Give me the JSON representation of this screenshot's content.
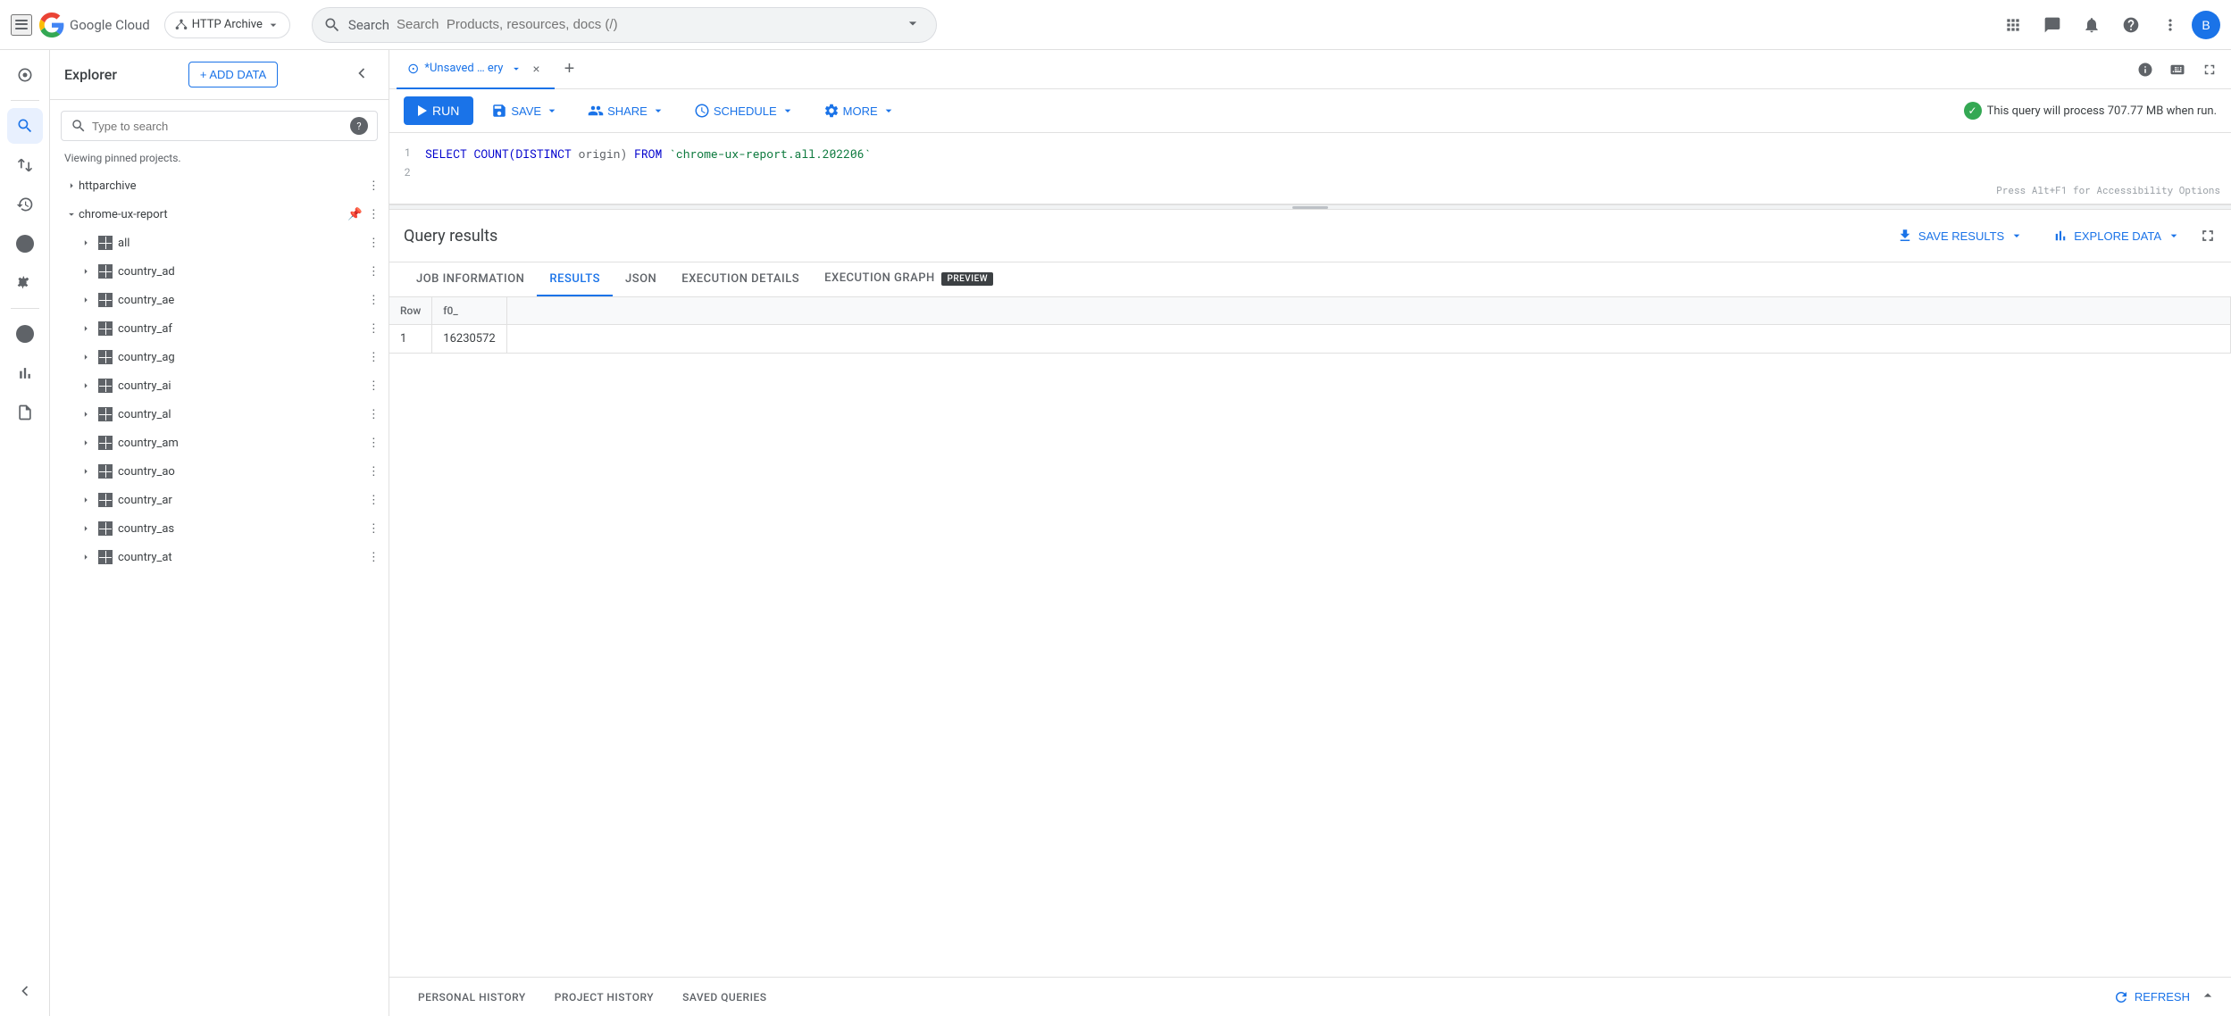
{
  "app": {
    "title": "Google Cloud"
  },
  "topnav": {
    "project_name": "HTTP Archive",
    "search_placeholder": "Search  Products, resources, docs (/)"
  },
  "explorer": {
    "title": "Explorer",
    "add_data_label": "+ ADD DATA",
    "search_placeholder": "Type to search",
    "viewing_text": "Viewing pinned projects.",
    "items": [
      {
        "id": "httparchive",
        "label": "httparchive",
        "level": 0,
        "type": "project",
        "expanded": false,
        "pinned": false
      },
      {
        "id": "chrome-ux-report",
        "label": "chrome-ux-report",
        "level": 0,
        "type": "project",
        "expanded": true,
        "pinned": true
      },
      {
        "id": "all",
        "label": "all",
        "level": 1,
        "type": "dataset",
        "expanded": false
      },
      {
        "id": "country_ad",
        "label": "country_ad",
        "level": 1,
        "type": "dataset",
        "expanded": false
      },
      {
        "id": "country_ae",
        "label": "country_ae",
        "level": 1,
        "type": "dataset",
        "expanded": false
      },
      {
        "id": "country_af",
        "label": "country_af",
        "level": 1,
        "type": "dataset",
        "expanded": false
      },
      {
        "id": "country_ag",
        "label": "country_ag",
        "level": 1,
        "type": "dataset",
        "expanded": false
      },
      {
        "id": "country_ai",
        "label": "country_ai",
        "level": 1,
        "type": "dataset",
        "expanded": false
      },
      {
        "id": "country_al",
        "label": "country_al",
        "level": 1,
        "type": "dataset",
        "expanded": false
      },
      {
        "id": "country_am",
        "label": "country_am",
        "level": 1,
        "type": "dataset",
        "expanded": false
      },
      {
        "id": "country_ao",
        "label": "country_ao",
        "level": 1,
        "type": "dataset",
        "expanded": false
      },
      {
        "id": "country_ar",
        "label": "country_ar",
        "level": 1,
        "type": "dataset",
        "expanded": false
      },
      {
        "id": "country_as",
        "label": "country_as",
        "level": 1,
        "type": "dataset",
        "expanded": false
      },
      {
        "id": "country_at",
        "label": "country_at",
        "level": 1,
        "type": "dataset",
        "expanded": false
      }
    ]
  },
  "query_tab": {
    "label": "*Unsaved … ery",
    "icon": "⊙"
  },
  "toolbar": {
    "run_label": "RUN",
    "save_label": "SAVE",
    "share_label": "SHARE",
    "schedule_label": "SCHEDULE",
    "more_label": "MORE",
    "query_info": "This query will process 707.77 MB when run."
  },
  "code_editor": {
    "line1": "SELECT COUNT(DISTINCT origin) FROM `chrome-ux-report.all.202206`",
    "line2": "",
    "accessibility_hint": "Press Alt+F1 for Accessibility Options"
  },
  "results": {
    "title": "Query results",
    "save_results_label": "SAVE RESULTS",
    "explore_data_label": "EXPLORE DATA",
    "tabs": [
      {
        "id": "job-info",
        "label": "JOB INFORMATION",
        "active": false
      },
      {
        "id": "results",
        "label": "RESULTS",
        "active": true
      },
      {
        "id": "json",
        "label": "JSON",
        "active": false
      },
      {
        "id": "execution-details",
        "label": "EXECUTION DETAILS",
        "active": false
      },
      {
        "id": "execution-graph",
        "label": "EXECUTION GRAPH",
        "active": false,
        "badge": "PREVIEW"
      }
    ],
    "table": {
      "columns": [
        "Row",
        "f0_"
      ],
      "rows": [
        {
          "row": "1",
          "f0_": "16230572"
        }
      ]
    }
  },
  "history_bar": {
    "tabs": [
      {
        "id": "personal-history",
        "label": "PERSONAL HISTORY"
      },
      {
        "id": "project-history",
        "label": "PROJECT HISTORY"
      },
      {
        "id": "saved-queries",
        "label": "SAVED QUERIES"
      }
    ],
    "refresh_label": "REFRESH"
  }
}
